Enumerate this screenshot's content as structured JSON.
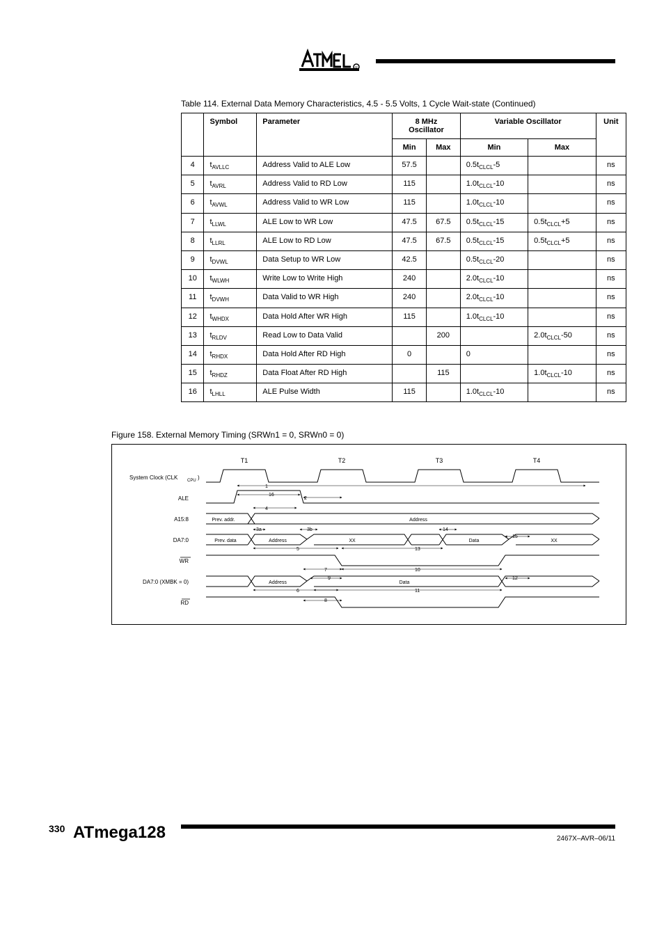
{
  "header": {
    "logo_alt": "Atmel"
  },
  "table_label": "Table 114.  External Data Memory Characteristics, 4.5 - 5.5 Volts, 1 Cycle Wait-state (Continued)",
  "table": {
    "headers": [
      "",
      "Symbol",
      "Parameter",
      "8 MHz Oscillator",
      "Variable Oscillator",
      "Unit"
    ],
    "subheaders": [
      "",
      "",
      "",
      "Min  Max",
      "Min          Max",
      ""
    ],
    "header_min": "Min",
    "header_max": "Max",
    "rows": [
      {
        "n": "4",
        "sym": "t_AVLLC",
        "param": "Address Valid to ALE Low",
        "osc8_min": "57.5",
        "osc8_max": "",
        "var_min": "0.5t_CLCL-5",
        "var_max": "",
        "unit": "ns"
      },
      {
        "n": "5",
        "sym": "t_AVRL",
        "param": "Address Valid to RD Low",
        "osc8_min": "115",
        "osc8_max": "",
        "var_min": "1.0t_CLCL-10",
        "var_max": "",
        "unit": "ns"
      },
      {
        "n": "6",
        "sym": "t_AVWL",
        "param": "Address Valid to WR Low",
        "osc8_min": "115",
        "osc8_max": "",
        "var_min": "1.0t_CLCL-10",
        "var_max": "",
        "unit": "ns"
      },
      {
        "n": "7",
        "sym": "t_LLWL",
        "param": "ALE Low to WR Low",
        "osc8_min": "47.5",
        "osc8_max": "67.5",
        "var_min": "0.5t_CLCL-15",
        "var_max": "0.5t_CLCL+5",
        "unit": "ns"
      },
      {
        "n": "8",
        "sym": "t_LLRL",
        "param": "ALE Low to RD Low",
        "osc8_min": "47.5",
        "osc8_max": "67.5",
        "var_min": "0.5t_CLCL-15",
        "var_max": "0.5t_CLCL+5",
        "unit": "ns"
      },
      {
        "n": "9",
        "sym": "t_DVWL",
        "param": "Data Setup to WR Low",
        "osc8_min": "42.5",
        "osc8_max": "",
        "var_min": "0.5t_CLCL-20",
        "var_max": "",
        "unit": "ns"
      },
      {
        "n": "10",
        "sym": "t_WLWH",
        "param": "Write Low to Write High",
        "osc8_min": "240",
        "osc8_max": "",
        "var_min": "2.0t_CLCL-10",
        "var_max": "",
        "unit": "ns"
      },
      {
        "n": "11",
        "sym": "t_DVWH",
        "param": "Data Valid to WR High",
        "osc8_min": "240",
        "osc8_max": "",
        "var_min": "2.0t_CLCL-10",
        "var_max": "",
        "unit": "ns"
      },
      {
        "n": "12",
        "sym": "t_WHDX",
        "param": "Data Hold After WR High",
        "osc8_min": "115",
        "osc8_max": "",
        "var_min": "1.0t_CLCL-10",
        "var_max": "",
        "unit": "ns"
      },
      {
        "n": "13",
        "sym": "t_RLDV",
        "param": "Read Low to Data Valid",
        "osc8_min": "",
        "osc8_max": "200",
        "var_min": "",
        "var_max": "2.0t_CLCL-50",
        "unit": "ns"
      },
      {
        "n": "14",
        "sym": "t_RHDX",
        "param": "Data Hold After RD High",
        "osc8_min": "0",
        "osc8_max": "",
        "var_min": "0",
        "var_max": "",
        "unit": "ns"
      },
      {
        "n": "15",
        "sym": "t_RHDZ",
        "param": "Data Float After RD High",
        "osc8_min": "",
        "osc8_max": "115",
        "var_min": "",
        "var_max": "1.0t_CLCL-10",
        "unit": "ns"
      },
      {
        "n": "16",
        "sym": "t_LHLL",
        "param": "ALE Pulse Width",
        "osc8_min": "115",
        "osc8_max": "",
        "var_min": "1.0t_CLCL-10",
        "var_max": "",
        "unit": "ns"
      }
    ]
  },
  "figure": {
    "caption": "Figure 158.  External Memory Timing (SRWn1 = 0, SRWn0 = 0)",
    "top_labels": [
      "T1",
      "T2",
      "T3",
      "T4"
    ],
    "signals": [
      "System Clock (CLK_CPU)",
      "ALE",
      "A15:8",
      "DA7:0",
      "WR",
      "DA7:0",
      "RD"
    ],
    "da_read_label": "(DA7:0)",
    "da_write_label": "(DA7:0)",
    "bus_labels": {
      "a15_prev": "Prev. addr.",
      "a15_addr": "Address",
      "da_read_prev": "Prev. data",
      "da_read_addr": "Address",
      "da_read_data": "Data",
      "da_read_xx": "XX",
      "da_write_addr": "Address",
      "da_write_data": "Data",
      "da_write_xx": "XX"
    },
    "timing_nums": [
      "1",
      "2",
      "3a",
      "3b",
      "4",
      "5",
      "6",
      "7",
      "8",
      "9",
      "10",
      "11",
      "12",
      "13",
      "14",
      "15",
      "16"
    ]
  },
  "footer": {
    "page_num": "330",
    "doc_title": "ATmega128",
    "doc_id": "2467X–AVR–06/11"
  }
}
